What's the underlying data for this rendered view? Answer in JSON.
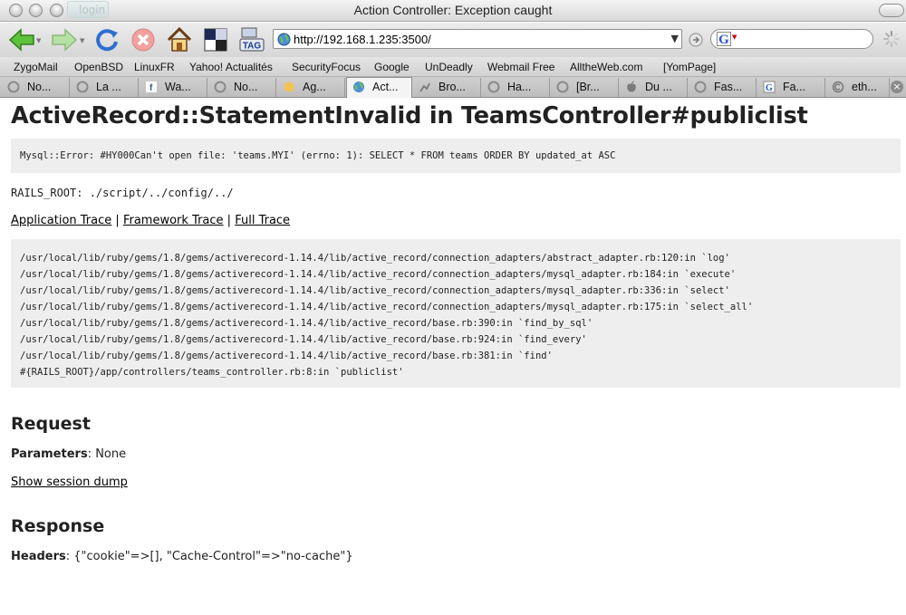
{
  "window": {
    "title": "Action Controller: Exception caught",
    "login_tab": "login"
  },
  "toolbar": {
    "url": "http://192.168.1.235:3500/",
    "icons": [
      "back-icon",
      "forward-icon",
      "reload-icon",
      "stop-icon",
      "home-icon",
      "tag-icon"
    ],
    "tag_label": "TAG",
    "search_engine_letter": "G"
  },
  "bookmarks": [
    "ZygoMail",
    "OpenBSD",
    "LinuxFR",
    "Yahoo! Actualités",
    "SecurityFocus",
    "Google",
    "UnDeadly",
    "Webmail Free",
    "AlltheWeb.com",
    "[YomPage]"
  ],
  "tabs": [
    {
      "label": "No...",
      "active": false
    },
    {
      "label": "La ...",
      "active": false
    },
    {
      "label": "Wa...",
      "active": false
    },
    {
      "label": "No...",
      "active": false
    },
    {
      "label": "Ag...",
      "active": false
    },
    {
      "label": "Act...",
      "active": true
    },
    {
      "label": "Bro...",
      "active": false
    },
    {
      "label": "Ha...",
      "active": false
    },
    {
      "label": "[Br...",
      "active": false
    },
    {
      "label": "Du ...",
      "active": false
    },
    {
      "label": "Fas...",
      "active": false
    },
    {
      "label": "Fa...",
      "active": false
    },
    {
      "label": "eth...",
      "active": false
    }
  ],
  "page": {
    "error_title": "ActiveRecord::StatementInvalid in TeamsController#publiclist",
    "error_message": "Mysql::Error: #HY000Can't open file: 'teams.MYI' (errno: 1): SELECT * FROM teams  ORDER BY updated_at ASC",
    "rails_root": "RAILS_ROOT: ./script/../config/../",
    "trace_links": {
      "application": "Application Trace",
      "framework": "Framework Trace",
      "full": "Full Trace",
      "separator": "|"
    },
    "trace": [
      "/usr/local/lib/ruby/gems/1.8/gems/activerecord-1.14.4/lib/active_record/connection_adapters/abstract_adapter.rb:120:in `log'",
      "/usr/local/lib/ruby/gems/1.8/gems/activerecord-1.14.4/lib/active_record/connection_adapters/mysql_adapter.rb:184:in `execute'",
      "/usr/local/lib/ruby/gems/1.8/gems/activerecord-1.14.4/lib/active_record/connection_adapters/mysql_adapter.rb:336:in `select'",
      "/usr/local/lib/ruby/gems/1.8/gems/activerecord-1.14.4/lib/active_record/connection_adapters/mysql_adapter.rb:175:in `select_all'",
      "/usr/local/lib/ruby/gems/1.8/gems/activerecord-1.14.4/lib/active_record/base.rb:390:in `find_by_sql'",
      "/usr/local/lib/ruby/gems/1.8/gems/activerecord-1.14.4/lib/active_record/base.rb:924:in `find_every'",
      "/usr/local/lib/ruby/gems/1.8/gems/activerecord-1.14.4/lib/active_record/base.rb:381:in `find'",
      "#{RAILS_ROOT}/app/controllers/teams_controller.rb:8:in `publiclist'"
    ],
    "request": {
      "heading": "Request",
      "params_label": "Parameters",
      "params_value": ": None",
      "session_link": "Show session dump"
    },
    "response": {
      "heading": "Response",
      "headers_label": "Headers",
      "headers_value": ": {\"cookie\"=>[], \"Cache-Control\"=>\"no-cache\"}"
    }
  }
}
